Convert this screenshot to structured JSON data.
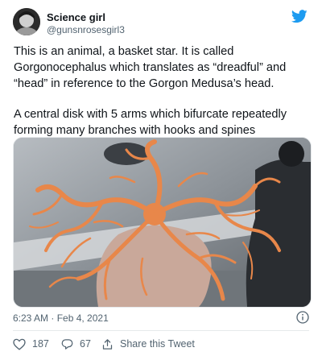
{
  "author": {
    "display_name": "Science girl",
    "handle": "@gunsnrosesgirl3"
  },
  "tweet": {
    "paragraph_1": "This is an animal, a basket star. It is called Gorgonocephalus which translates as “dreadful” and “head” in reference to the Gorgon Medusa’s head.",
    "paragraph_2": "A central disk with 5 arms which bifurcate repeatedly forming many branches with hooks and spines",
    "timestamp": "6:23 AM · Feb 4, 2021"
  },
  "actions": {
    "likes": "187",
    "replies": "67",
    "share_label": "Share this Tweet"
  },
  "colors": {
    "twitter_blue": "#1d9bf0",
    "secondary_text": "#536471",
    "basket_star_orange": "#e8874a"
  },
  "icons": {
    "brand": "twitter-bird-icon",
    "info": "info-icon",
    "like": "heart-icon",
    "reply": "speech-bubble-icon",
    "share": "share-icon"
  }
}
